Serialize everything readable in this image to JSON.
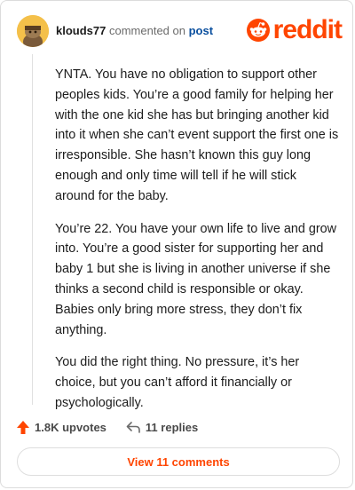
{
  "header": {
    "username": "klouds77",
    "action": "commented on",
    "post_link": "post",
    "logo_text": "reddit"
  },
  "comment": {
    "paragraphs": [
      "YNTA. You have no obligation to support other peoples kids. You’re a good family for helping her with the one kid she has but bringing another kid into it when she can’t event support the first one is irresponsible. She hasn’t known this guy long enough and only time will tell if he will stick around for the baby.",
      "You’re 22. You have your own life to live and grow into. You’re a good sister for supporting her and baby 1 but she is living in another universe if she thinks a second child is responsible or okay. Babies only bring more stress, they don’t fix anything.",
      "You did the right thing. No pressure, it’s her choice, but you can’t afford it financially or psychologically."
    ]
  },
  "actions": {
    "upvotes": "1.8K upvotes",
    "replies": "11 replies"
  },
  "view_button": "View 11 comments",
  "colors": {
    "brand": "#ff4500",
    "link": "#0a4f9e",
    "avatar_bg": "#f4c04a"
  }
}
